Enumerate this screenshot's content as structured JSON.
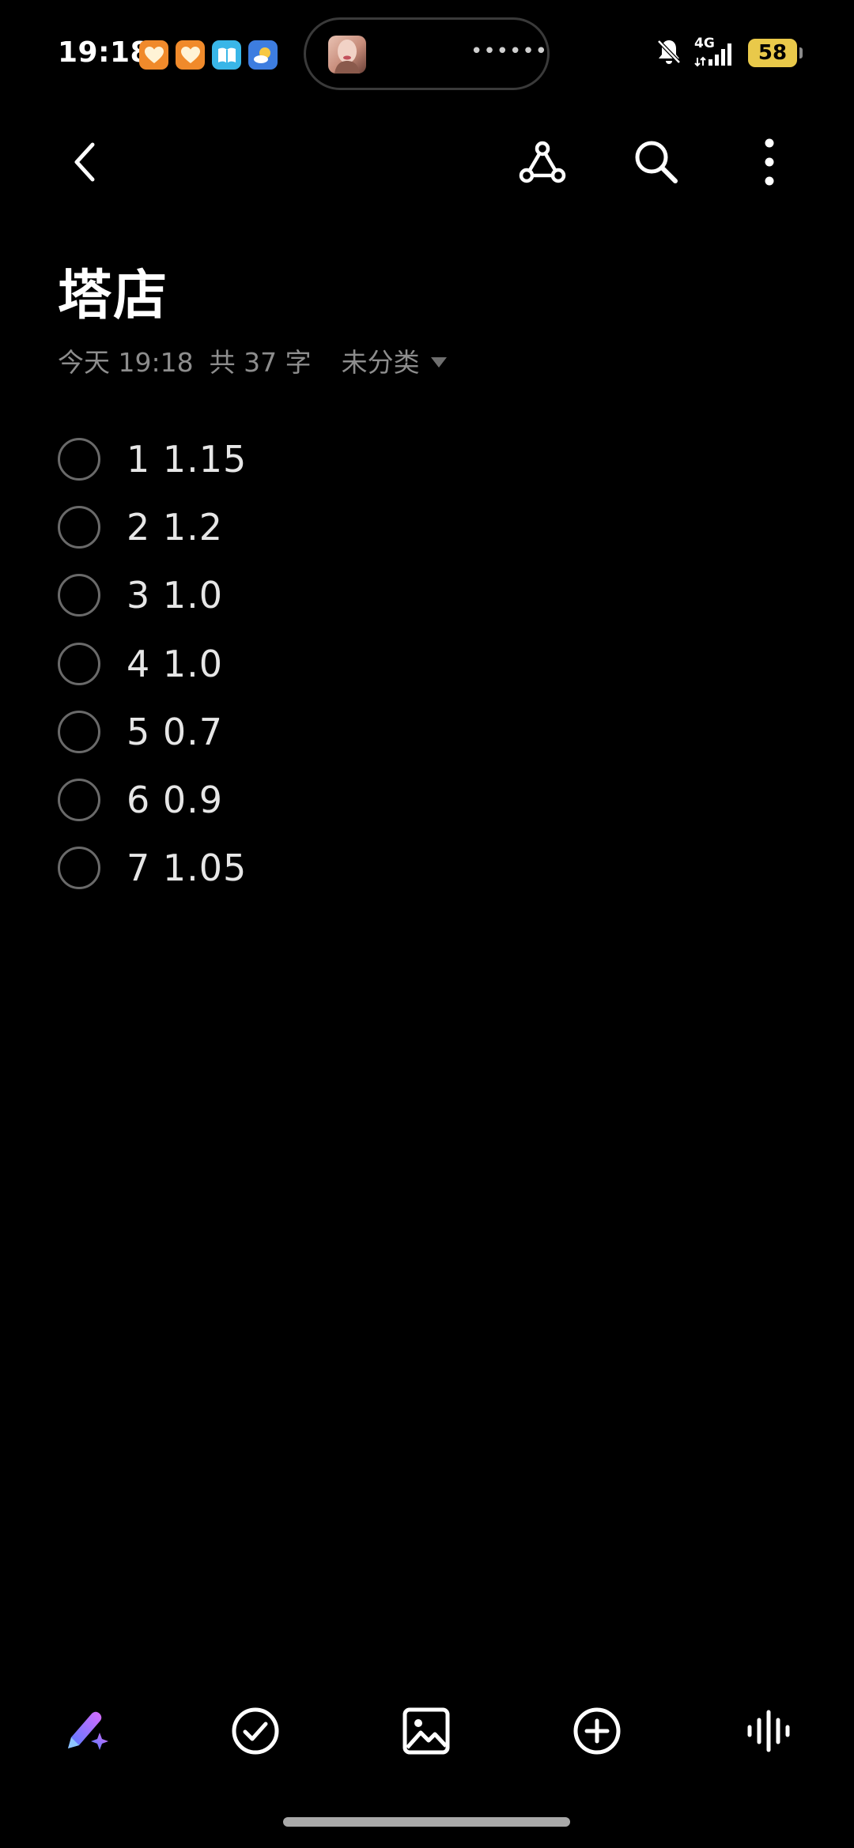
{
  "status_bar": {
    "time": "19:18",
    "network": "4G",
    "battery": "58",
    "island_indicator": "••••••",
    "icons": [
      "heart-app-icon",
      "heart-app-icon",
      "book-app-icon",
      "weather-icon",
      "mute-bell-icon",
      "signal-icon"
    ]
  },
  "note": {
    "title": "塔店",
    "date": "今天 19:18",
    "count": "共 37 字",
    "category": "未分类"
  },
  "checklist": [
    {
      "text": "1 1.15",
      "checked": false
    },
    {
      "text": "2 1.2",
      "checked": false
    },
    {
      "text": "3 1.0",
      "checked": false
    },
    {
      "text": "4 1.0",
      "checked": false
    },
    {
      "text": "5 0.7",
      "checked": false
    },
    {
      "text": "6 0.9",
      "checked": false
    },
    {
      "text": "7 1.05",
      "checked": false
    }
  ],
  "colors": {
    "background": "#000000",
    "text_primary": "#ffffff",
    "text_secondary": "#8d8d8d",
    "battery": "#e9c94a",
    "ai_gradient_start": "#4f7cff",
    "ai_gradient_end": "#d86bff"
  }
}
